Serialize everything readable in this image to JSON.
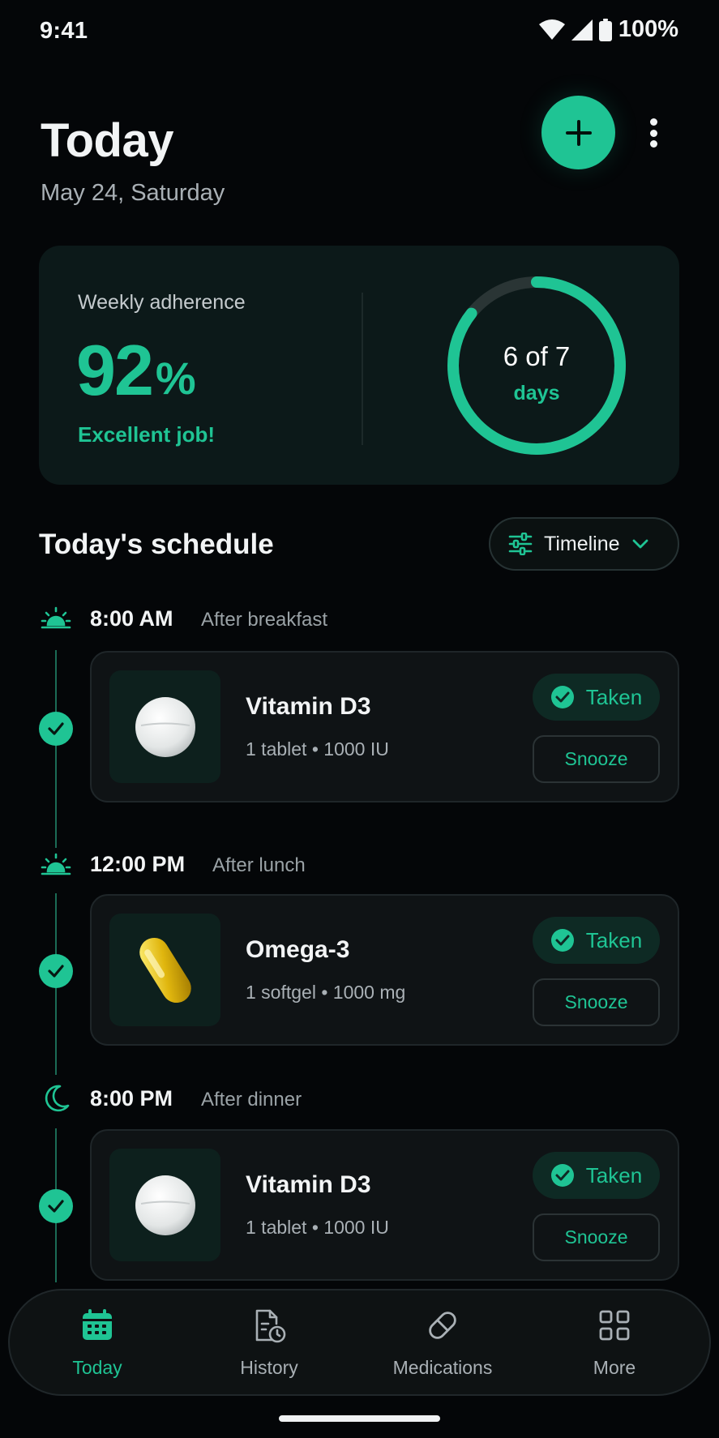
{
  "status_bar": {
    "time": "9:41",
    "battery": "100%"
  },
  "header": {
    "title": "Today",
    "date": "May 24, Saturday"
  },
  "adherence": {
    "label": "Weekly adherence",
    "value": "92",
    "unit": "%",
    "message": "Excellent job!",
    "ring_main": "6 of 7",
    "ring_sub": "days",
    "days_done": 6,
    "days_total": 7
  },
  "schedule": {
    "title": "Today's schedule",
    "view_label": "Timeline",
    "slots": [
      {
        "time": "8:00 AM",
        "note": "After breakfast",
        "icon": "sunrise-icon",
        "med": {
          "name": "Vitamin D3",
          "dose": "1 tablet • 1000 IU",
          "status": "Taken",
          "action": "Snooze",
          "pill": "white-tablet"
        }
      },
      {
        "time": "12:00 PM",
        "note": "After lunch",
        "icon": "sun-icon",
        "med": {
          "name": "Omega-3",
          "dose": "1 softgel • 1000 mg",
          "status": "Taken",
          "action": "Snooze",
          "pill": "yellow-softgel"
        }
      },
      {
        "time": "8:00 PM",
        "note": "After dinner",
        "icon": "moon-icon",
        "med": {
          "name": "Vitamin D3",
          "dose": "1 tablet • 1000 IU",
          "status": "Taken",
          "action": "Snooze",
          "pill": "white-tablet"
        }
      }
    ]
  },
  "nav": {
    "items": [
      {
        "label": "Today",
        "icon": "calendar-icon",
        "active": true
      },
      {
        "label": "History",
        "icon": "history-icon",
        "active": false
      },
      {
        "label": "Medications",
        "icon": "pill-icon",
        "active": false
      },
      {
        "label": "More",
        "icon": "grid-icon",
        "active": false
      }
    ]
  },
  "colors": {
    "accent": "#1fc494",
    "background": "#040608",
    "card": "#0c1919"
  }
}
